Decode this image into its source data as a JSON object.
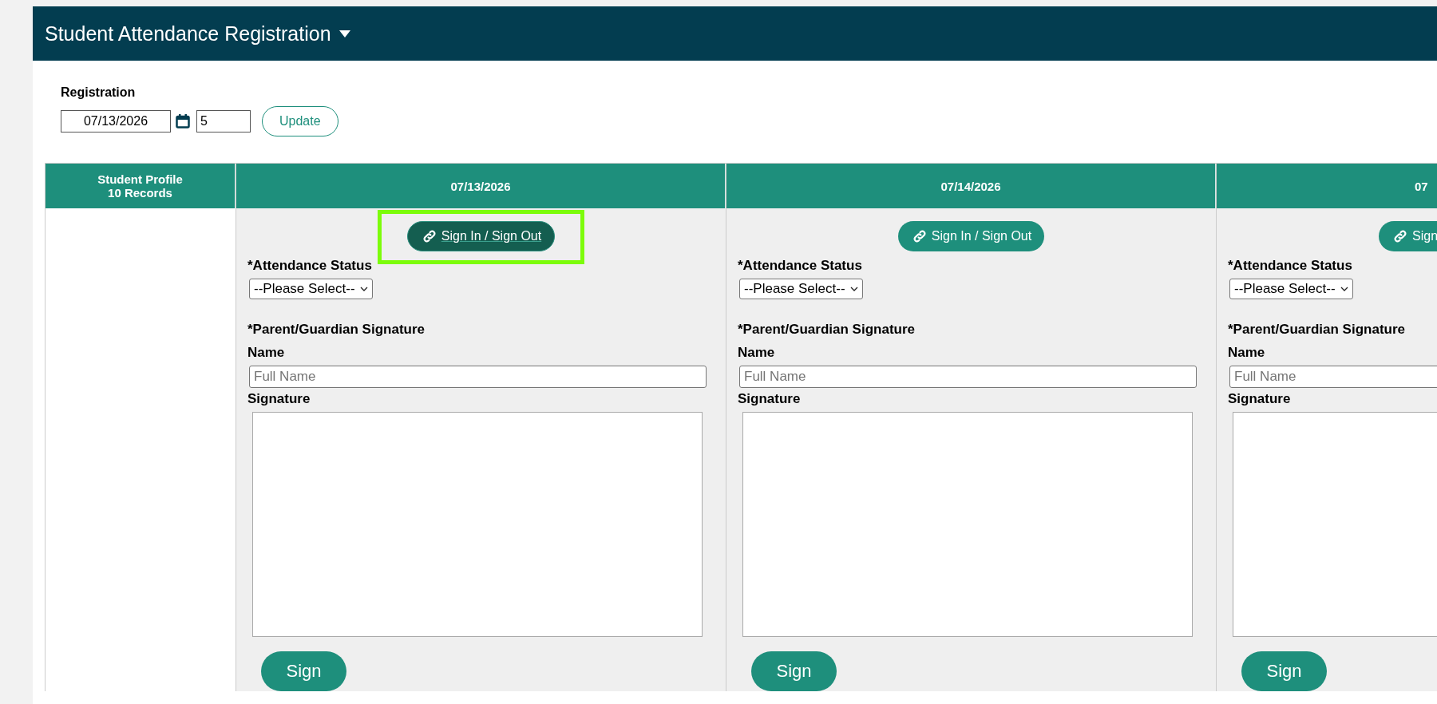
{
  "panel": {
    "title": "Student Attendance Registration"
  },
  "registration": {
    "label": "Registration",
    "date": "07/13/2026",
    "days": "5",
    "update_button": "Update"
  },
  "table": {
    "profile_header": [
      "Student Profile",
      "10 Records"
    ],
    "days": [
      {
        "date": "07/13/2026",
        "sign_in_button": "Sign In / Sign Out",
        "highlighted": true,
        "status_label": "*Attendance Status",
        "status_select": "--Please Select--",
        "signature_heading": "*Parent/Guardian Signature",
        "name_label": "Name",
        "name_placeholder": "Full Name",
        "signature_label": "Signature",
        "sign_button": "Sign"
      },
      {
        "date": "07/14/2026",
        "sign_in_button": "Sign In / Sign Out",
        "highlighted": false,
        "status_label": "*Attendance Status",
        "status_select": "--Please Select--",
        "signature_heading": "*Parent/Guardian Signature",
        "name_label": "Name",
        "name_placeholder": "Full Name",
        "signature_label": "Signature",
        "sign_button": "Sign"
      },
      {
        "date": "07",
        "sign_in_button": "Sign",
        "highlighted": false,
        "status_label": "*Attendance Status",
        "status_select": "--Please Select--",
        "signature_heading": "*Parent/Guardian Signature",
        "name_label": "Name",
        "name_placeholder": "Full Name",
        "signature_label": "Signature",
        "sign_button": "Sign"
      }
    ]
  }
}
